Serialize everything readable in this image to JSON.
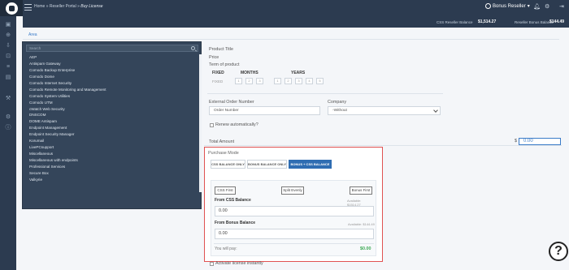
{
  "header": {
    "breadcrumb_home": "Home",
    "breadcrumb_sep1": "»",
    "breadcrumb_portal": "Reseller Portal",
    "breadcrumb_sep2": "»",
    "breadcrumb_current": "Buy License",
    "user_name": "Bonus Reseller"
  },
  "balances": {
    "css_label": "CSS Reseller Balance",
    "css_value": "$1,514.27",
    "bonus_label": "Reseller Bonus Balance",
    "bonus_value": "$144.49"
  },
  "area_tab": "Area",
  "categories": {
    "search_placeholder": "Search",
    "items": [
      "AEP",
      "Antispam Gateway",
      "Comodo Backup Enterprise",
      "Comodo Dome",
      "Comodo Internet Security",
      "Comodo Remote Monitoring and Management",
      "Comodo System Utilities",
      "Comodo UTM",
      "cWatch Web Security",
      "DNSCOM",
      "DOME Antispam",
      "Endpoint Management",
      "Endpoint Security Manager",
      "Korumail",
      "LivePCsupport",
      "Miscellaneous",
      "Miscellaneous with endpoints",
      "Professional Services",
      "Secure Box",
      "Valkyrie"
    ]
  },
  "product": {
    "title_label": "Product Title",
    "price_label": "Price",
    "term_label": "Term of product",
    "fixed_label": "FIXED",
    "months_label": "MONTHS",
    "years_label": "YEARS",
    "fixed_values": [
      "FIXED"
    ],
    "months_values": [
      "1",
      "2",
      "3"
    ],
    "years_values": [
      "1",
      "2",
      "3",
      "4",
      "5"
    ]
  },
  "order": {
    "external_label": "External Order Number",
    "external_placeholder": "Order Number",
    "company_label": "Company",
    "company_value": "-Without",
    "renew_label": "Renew automatically?",
    "total_label": "Total Amount",
    "currency": "$",
    "total_value": "0.00"
  },
  "purchase_mode": {
    "title": "Purchase Mode",
    "modes": [
      "CSS BALANCE ONLY",
      "BONUS BALANCE ONLY",
      "BONUS + CSS BALANCE"
    ],
    "active_mode": "BONUS + CSS BALANCE",
    "css_first": "CSS First",
    "split_evenly": "Split Evenly",
    "bonus_first": "Bonus First",
    "from_css_label": "From CSS Balance",
    "css_available": "Available: $1514.27",
    "css_amount": "0.00",
    "from_bonus_label": "From Bonus Balance",
    "bonus_available": "Available: $144.49",
    "bonus_amount": "0.00",
    "you_will_pay_label": "You will pay:",
    "you_will_pay_value": "$0.00"
  },
  "activate_label": "Activate license instantly",
  "help_label": "?"
}
